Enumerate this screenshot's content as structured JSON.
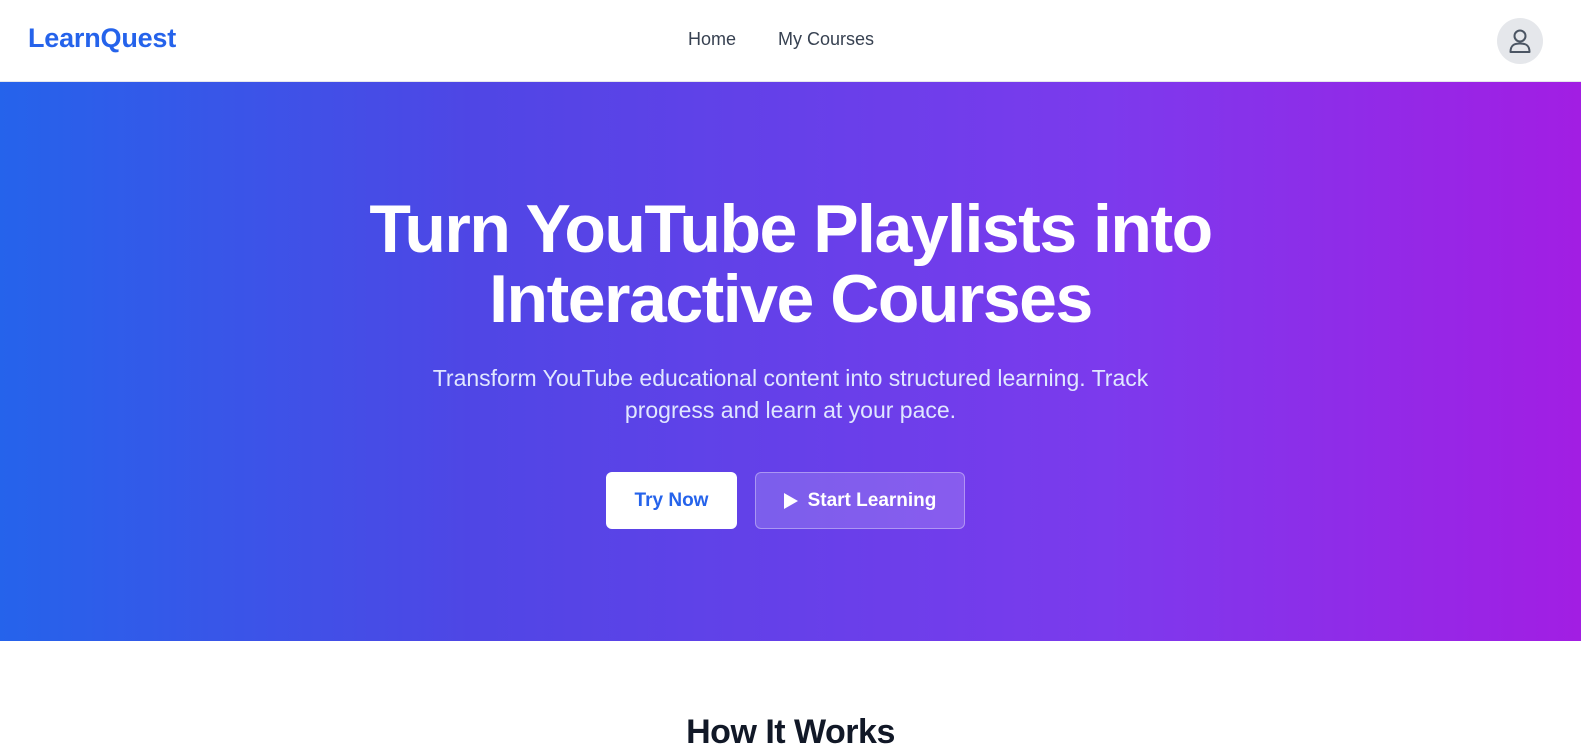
{
  "nav": {
    "brand": "LearnQuest",
    "links": [
      {
        "label": "Home"
      },
      {
        "label": "My Courses"
      }
    ],
    "avatar_icon": "user-icon"
  },
  "hero": {
    "title_line1": "Turn YouTube Playlists into",
    "title_line2": "Interactive Courses",
    "subtitle_line1": "Transform YouTube educational content into structured learning. Track",
    "subtitle_line2": "progress and learn at your pace.",
    "try_now_label": "Try Now",
    "start_learning_label": "Start Learning",
    "start_learning_icon": "play-icon",
    "gradient_colors": [
      "#2563eb",
      "#4f46e5",
      "#7c3aed",
      "#a21ee3"
    ]
  },
  "section": {
    "title": "How It Works"
  },
  "colors": {
    "brand": "#2563eb",
    "nav_text": "#374151",
    "heading_text": "#111827"
  }
}
